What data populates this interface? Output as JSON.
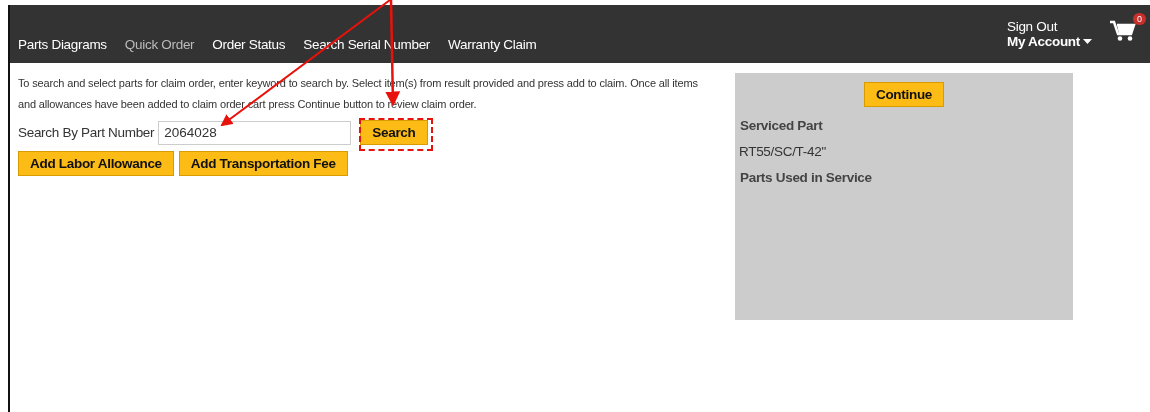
{
  "nav": {
    "items": [
      {
        "label": "Parts Diagrams",
        "selected": false
      },
      {
        "label": "Quick Order",
        "selected": true
      },
      {
        "label": "Order Status",
        "selected": false
      },
      {
        "label": "Search Serial Number",
        "selected": false
      },
      {
        "label": "Warranty Claim",
        "selected": false
      }
    ],
    "sign_out": "Sign Out",
    "account": "My Account",
    "cart_count": "0"
  },
  "instructions": "To search and select parts for claim order, enter keyword to search by. Select item(s) from result provided and press add to claim. Once all items and allowances have been added to claim order cart press Continue button to review claim order.",
  "search": {
    "label": "Search By Part Number",
    "value": "2064028",
    "button": "Search"
  },
  "buttons": [
    "Add Labor Allowance",
    "Add Transportation Fee"
  ],
  "panel": {
    "button": "Continue",
    "serviced_heading": "Serviced Part",
    "serviced_value": "RT55/SC/T-42\"",
    "used_heading": "Parts Used in Service"
  }
}
